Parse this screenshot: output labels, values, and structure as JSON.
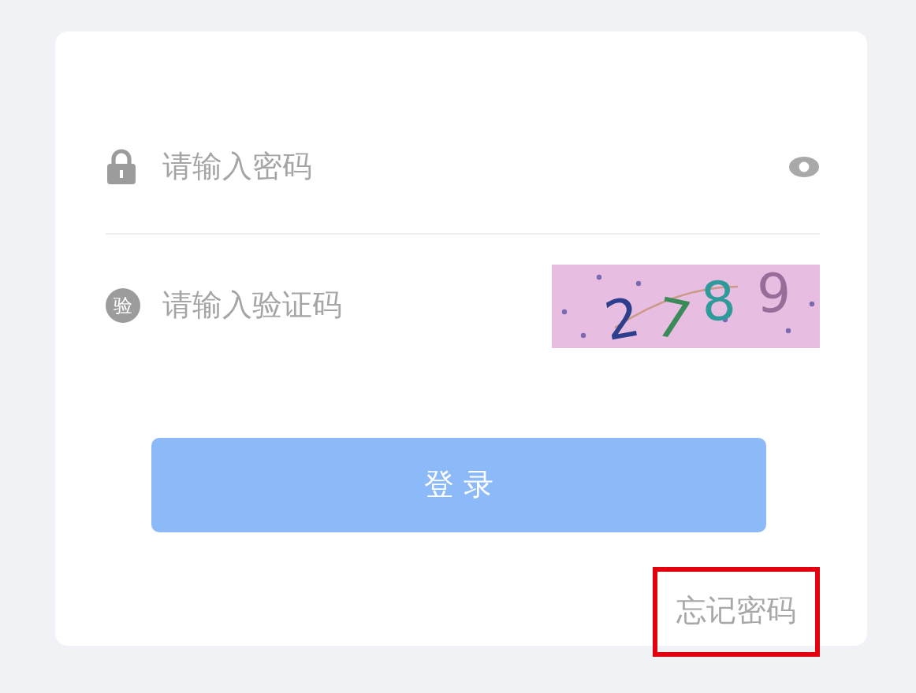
{
  "password_field": {
    "placeholder": "请输入密码"
  },
  "captcha_field": {
    "icon_text": "验",
    "placeholder": "请输入验证码"
  },
  "captcha_image": {
    "characters": [
      {
        "char": "2",
        "color": "#2c3e8c"
      },
      {
        "char": "7",
        "color": "#3a8a5a"
      },
      {
        "char": "8",
        "color": "#2f9a9a"
      },
      {
        "char": "9",
        "color": "#9a6c9a"
      }
    ]
  },
  "login_button": {
    "label": "登 录"
  },
  "forgot_link": {
    "label": "忘记密码",
    "highlighted": true
  }
}
